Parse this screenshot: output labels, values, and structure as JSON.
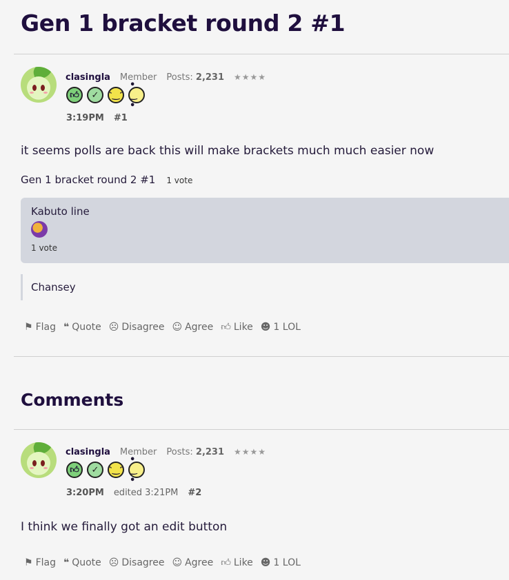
{
  "discussion": {
    "title": "Gen 1 bracket round 2 #1"
  },
  "post": {
    "author": "clasingla",
    "role": "Member",
    "posts_label": "Posts:",
    "posts_count": "2,231",
    "stars": "★★★★",
    "time": "3:19PM",
    "number": "#1",
    "body": "it seems polls are back this will make brackets much much easier now",
    "poll": {
      "title": "Gen 1 bracket round 2 #1",
      "total_votes": "1 vote",
      "options": [
        {
          "label": "Kabuto line",
          "votes": "1 vote",
          "share": 1.0
        },
        {
          "label": "Chansey",
          "votes": "",
          "share": 0.0
        }
      ]
    }
  },
  "actions": {
    "flag": "Flag",
    "quote": "Quote",
    "disagree": "Disagree",
    "agree": "Agree",
    "like": "Like",
    "lol": "1 LOL"
  },
  "comments": {
    "heading": "Comments",
    "items": [
      {
        "author": "clasingla",
        "role": "Member",
        "posts_label": "Posts:",
        "posts_count": "2,231",
        "stars": "★★★★",
        "time": "3:20PM",
        "edited": "edited 3:21PM",
        "number": "#2",
        "body": "I think we finally got an edit button"
      }
    ]
  },
  "icons": {
    "flag": "flag-icon",
    "quote": "quote-icon",
    "disagree": "frown-icon",
    "agree": "smile-icon",
    "like": "thumbs-up-icon",
    "lol": "laugh-icon"
  }
}
